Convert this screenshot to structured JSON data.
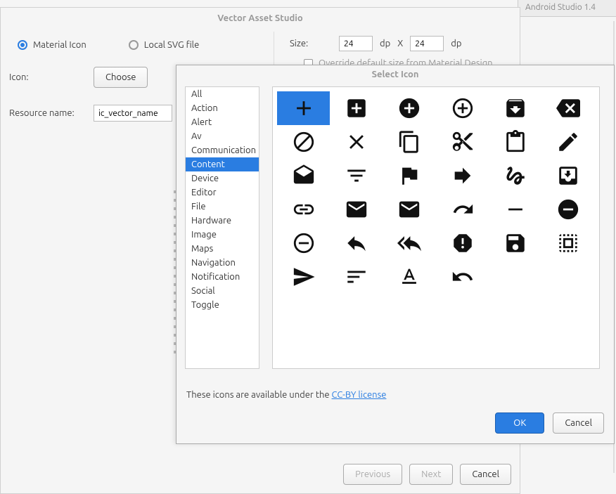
{
  "header": {
    "corner_tab": "Android Studio 1.4"
  },
  "vas": {
    "title": "Vector Asset Studio",
    "source": {
      "material_label": "Material Icon",
      "localsvg_label": "Local SVG file"
    },
    "icon_label": "Icon:",
    "choose_label": "Choose",
    "resource_label": "Resource name:",
    "resource_value": "ic_vector_name",
    "size": {
      "label": "Size:",
      "width": "24",
      "height": "24",
      "dp1": "dp",
      "x": "X",
      "dp2": "dp"
    },
    "override_label": "Override default size from Material Design",
    "buttons": {
      "previous": "Previous",
      "next": "Next",
      "cancel": "Cancel"
    }
  },
  "dialog": {
    "title": "Select Icon",
    "categories": [
      "All",
      "Action",
      "Alert",
      "Av",
      "Communication",
      "Content",
      "Device",
      "Editor",
      "File",
      "Hardware",
      "Image",
      "Maps",
      "Navigation",
      "Notification",
      "Social",
      "Toggle"
    ],
    "selected_category": "Content",
    "icons": [
      "add-icon",
      "add-box-icon",
      "add-circle-icon",
      "add-circle-outline-icon",
      "archive-icon",
      "backspace-icon",
      "block-icon",
      "clear-icon",
      "content-copy-icon",
      "content-cut-icon",
      "content-paste-icon",
      "create-icon",
      "drafts-icon",
      "filter-list-icon",
      "flag-icon",
      "forward-icon",
      "gesture-icon",
      "inbox-icon",
      "link-icon",
      "mail-icon",
      "markunread-icon",
      "redo-icon",
      "remove-icon",
      "remove-circle-icon",
      "remove-circle-outline-icon",
      "reply-icon",
      "reply-all-icon",
      "report-icon",
      "save-icon",
      "select-all-icon",
      "send-icon",
      "sort-icon",
      "text-format-icon",
      "undo-icon"
    ],
    "selected_icon": "add-icon",
    "credit_prefix": "These icons are available under the ",
    "credit_link": "CC-BY license",
    "buttons": {
      "ok": "OK",
      "cancel": "Cancel"
    }
  }
}
